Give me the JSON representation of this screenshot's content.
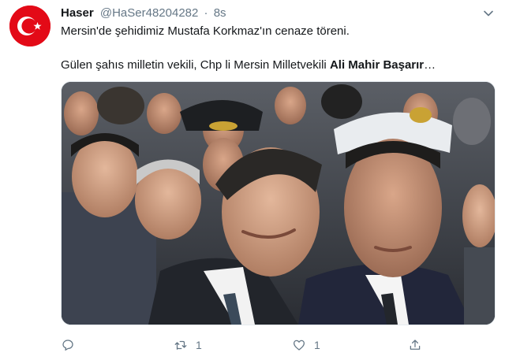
{
  "tweet": {
    "author": {
      "display_name": "Haser",
      "handle": "@HaSer48204282",
      "separator": "·",
      "time": "8s"
    },
    "text_line1": "Mersin'de şehidimiz Mustafa Korkmaz'ın cenaze töreni.",
    "text_line2_prefix": "Gülen şahıs milletin vekili,  Chp li Mersin Milletvekili ",
    "text_line2_bold": "Ali Mahir Başarır",
    "text_line2_suffix": "…",
    "actions": {
      "reply_count": "",
      "retweet_count": "1",
      "like_count": "1"
    }
  },
  "icons": {
    "avatar": "turkish-flag",
    "caret": "chevron-down-icon",
    "reply": "reply-icon",
    "retweet": "retweet-icon",
    "like": "heart-icon",
    "share": "share-icon"
  },
  "colors": {
    "text": "#14171a",
    "secondary": "#657786",
    "flag_red": "#e30a17"
  }
}
